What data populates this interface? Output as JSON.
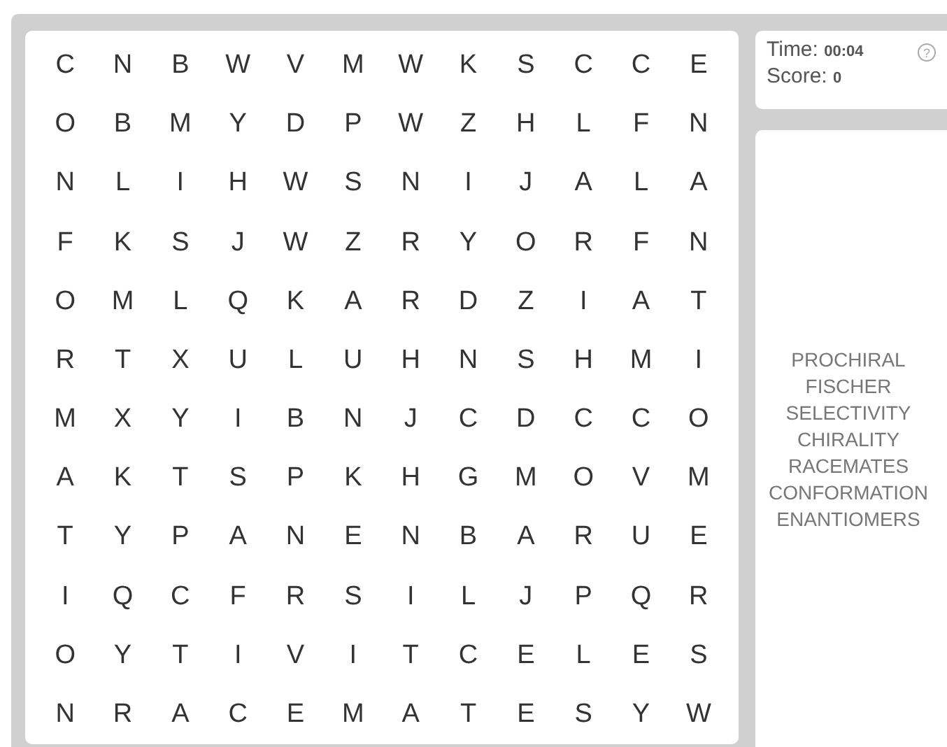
{
  "grid": {
    "rows": [
      [
        "C",
        "N",
        "B",
        "W",
        "V",
        "M",
        "W",
        "K",
        "S",
        "C",
        "C",
        "E"
      ],
      [
        "O",
        "B",
        "M",
        "Y",
        "D",
        "P",
        "W",
        "Z",
        "H",
        "L",
        "F",
        "N"
      ],
      [
        "N",
        "L",
        "I",
        "H",
        "W",
        "S",
        "N",
        "I",
        "J",
        "A",
        "L",
        "A"
      ],
      [
        "F",
        "K",
        "S",
        "J",
        "W",
        "Z",
        "R",
        "Y",
        "O",
        "R",
        "F",
        "N"
      ],
      [
        "O",
        "M",
        "L",
        "Q",
        "K",
        "A",
        "R",
        "D",
        "Z",
        "I",
        "A",
        "T"
      ],
      [
        "R",
        "T",
        "X",
        "U",
        "L",
        "U",
        "H",
        "N",
        "S",
        "H",
        "M",
        "I"
      ],
      [
        "M",
        "X",
        "Y",
        "I",
        "B",
        "N",
        "J",
        "C",
        "D",
        "C",
        "C",
        "O"
      ],
      [
        "A",
        "K",
        "T",
        "S",
        "P",
        "K",
        "H",
        "G",
        "M",
        "O",
        "V",
        "M"
      ],
      [
        "T",
        "Y",
        "P",
        "A",
        "N",
        "E",
        "N",
        "B",
        "A",
        "R",
        "U",
        "E"
      ],
      [
        "I",
        "Q",
        "C",
        "F",
        "R",
        "S",
        "I",
        "L",
        "J",
        "P",
        "Q",
        "R"
      ],
      [
        "O",
        "Y",
        "T",
        "I",
        "V",
        "I",
        "T",
        "C",
        "E",
        "L",
        "E",
        "S"
      ],
      [
        "N",
        "R",
        "A",
        "C",
        "E",
        "M",
        "A",
        "T",
        "E",
        "S",
        "Y",
        "W"
      ]
    ]
  },
  "status": {
    "time_label": "Time:",
    "time": "00:04",
    "score_label": "Score:",
    "score": "0",
    "help": "?"
  },
  "words": [
    "PROCHIRAL",
    "FISCHER",
    "SELECTIVITY",
    "CHIRALITY",
    "RACEMATES",
    "CONFORMATION",
    "ENANTIOMERS"
  ]
}
